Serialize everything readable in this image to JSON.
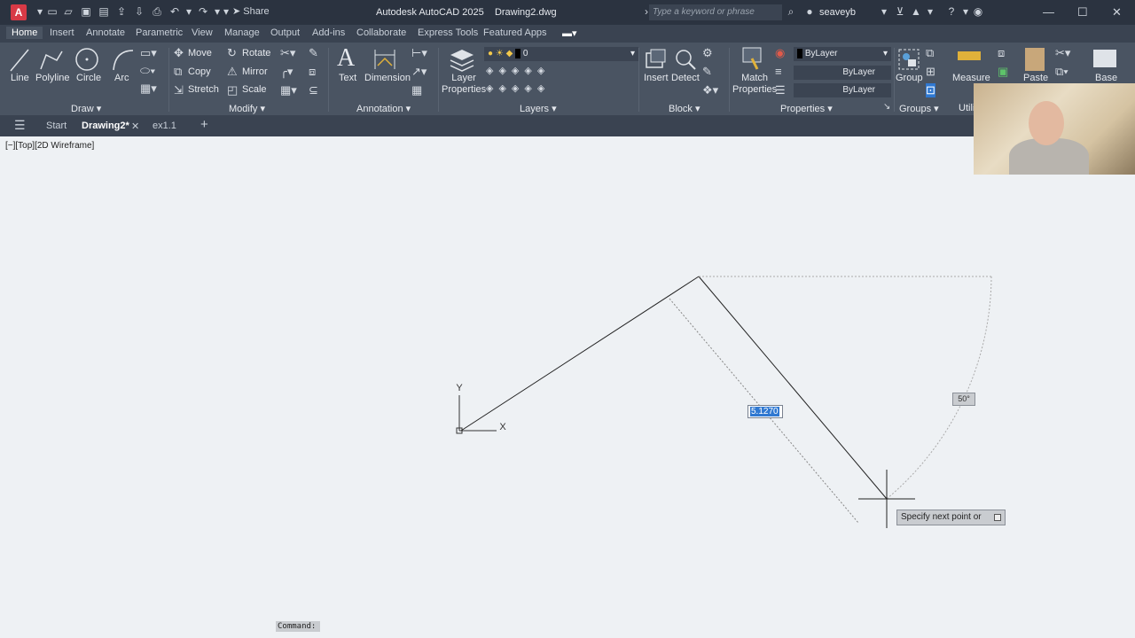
{
  "titlebar": {
    "logo": "A",
    "share": "Share",
    "app_title": "Autodesk AutoCAD 2025",
    "doc_title": "Drawing2.dwg",
    "search_placeholder": "Type a keyword or phrase",
    "user": "seaveyb"
  },
  "tabs": [
    "Home",
    "Insert",
    "Annotate",
    "Parametric",
    "View",
    "Manage",
    "Output",
    "Add-ins",
    "Collaborate",
    "Express Tools",
    "Featured Apps"
  ],
  "ribbon": {
    "draw": {
      "line": "Line",
      "polyline": "Polyline",
      "circle": "Circle",
      "arc": "Arc",
      "group": "Draw"
    },
    "modify": {
      "move": "Move",
      "rotate": "Rotate",
      "copy": "Copy",
      "mirror": "Mirror",
      "stretch": "Stretch",
      "scale": "Scale",
      "group": "Modify"
    },
    "annotation": {
      "text": "Text",
      "dimension": "Dimension",
      "group": "Annotation"
    },
    "layers": {
      "layer_properties": "Layer\nProperties",
      "layer_props_1": "Layer",
      "layer_props_2": "Properties",
      "current_layer": "0",
      "group": "Layers"
    },
    "block": {
      "insert": "Insert",
      "detect": "Detect",
      "group": "Block"
    },
    "properties": {
      "match_1": "Match",
      "match_2": "Properties",
      "color": "ByLayer",
      "linetype": "ByLayer",
      "lineweight": "ByLayer",
      "group": "Properties"
    },
    "groups": {
      "group": "Group",
      "group_label": "Groups"
    },
    "utilities": {
      "measure": "Measure",
      "group": "Utili"
    },
    "clipboard": {
      "paste": "Paste"
    },
    "view": {
      "base": "Base"
    }
  },
  "filetabs": {
    "start": "Start",
    "active": "Drawing2*",
    "other": "ex1.1"
  },
  "canvas": {
    "view_label": "[−][Top][2D Wireframe]",
    "ucs_y": "Y",
    "ucs_x": "X",
    "dyn_length": "5.1270",
    "dyn_angle": "50°",
    "prompt": "Specify next point or",
    "command": "Command:"
  }
}
